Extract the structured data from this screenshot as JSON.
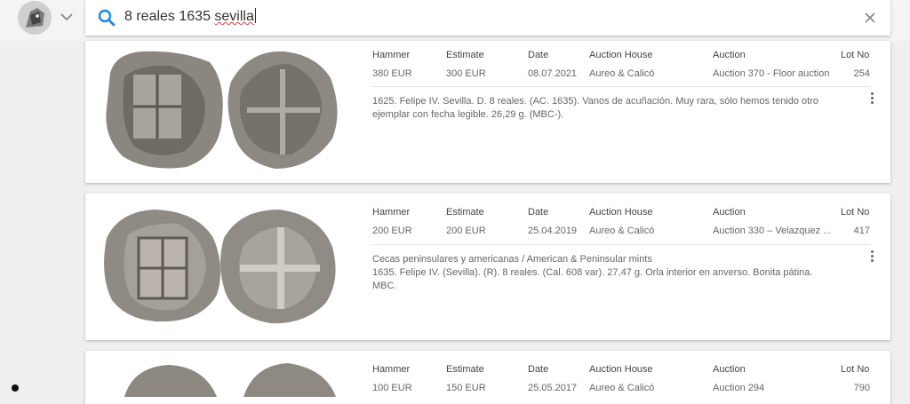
{
  "search": {
    "query_plain": "8 reales 1635 ",
    "query_misspelled": "sevilla"
  },
  "columns": {
    "hammer": "Hammer",
    "estimate": "Estimate",
    "date": "Date",
    "auction_house": "Auction House",
    "auction": "Auction",
    "lot_no": "Lot No"
  },
  "results": [
    {
      "hammer": "380 EUR",
      "estimate": "300 EUR",
      "date": "08.07.2021",
      "auction_house": "Aureo & Calicó",
      "auction": "Auction 370 - Floor auction",
      "lot_no": "254",
      "desc1": "1625. Felipe IV. Sevilla. D. 8 reales. (AC. 1635). Vanos de acuñación. Muy rara, sólo hemos tenido otro",
      "desc2": "ejemplar con fecha legible. 26,29 g. (MBC-).",
      "desc3": ""
    },
    {
      "hammer": "200 EUR",
      "estimate": "200 EUR",
      "date": "25.04.2019",
      "auction_house": "Aureo & Calicó",
      "auction": "Auction 330 – Velazquez ...",
      "lot_no": "417",
      "desc1": "Cecas peninsulares y americanas / American & Peninsular mints",
      "desc2": "1635. Felipe IV. (Sevilla). (R). 8 reales. (Cal. 608 var). 27,47 g. Orla interior en anverso. Bonita pátina.",
      "desc3": "MBC."
    },
    {
      "hammer": "100 EUR",
      "estimate": "150 EUR",
      "date": "25.05.2017",
      "auction_house": "Aureo & Calicó",
      "auction": "Auction 294",
      "lot_no": "790"
    }
  ],
  "colors": {
    "accent": "#1e88e5",
    "background": "#efefef"
  }
}
